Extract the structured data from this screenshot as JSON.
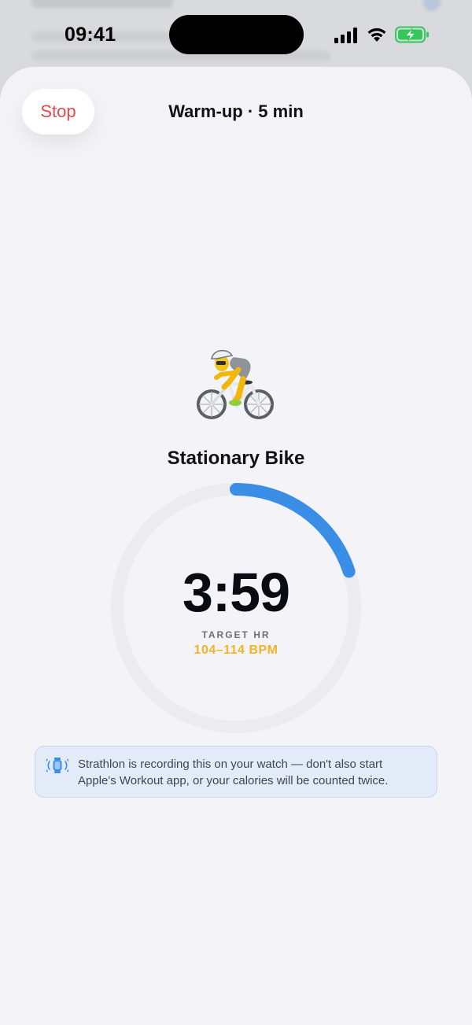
{
  "status_bar": {
    "time": "09:41"
  },
  "header": {
    "stop_label": "Stop",
    "title": "Warm-up · 5 min"
  },
  "workout": {
    "icon": "person-biking-icon",
    "name": "Stationary Bike",
    "timer": "3:59",
    "target_label": "TARGET HR",
    "target_value": "104–114 BPM",
    "progress_fraction": 0.2
  },
  "notice": {
    "icon": "watch-icon",
    "line1": "Strathlon is recording this on your watch — don't also start",
    "line2": "Apple's Workout app, or your calories will be counted twice."
  },
  "colors": {
    "accent_blue": "#3b8ee6",
    "stop_red": "#e5484d",
    "target_yellow": "#f0b429",
    "battery_green": "#34c759"
  }
}
